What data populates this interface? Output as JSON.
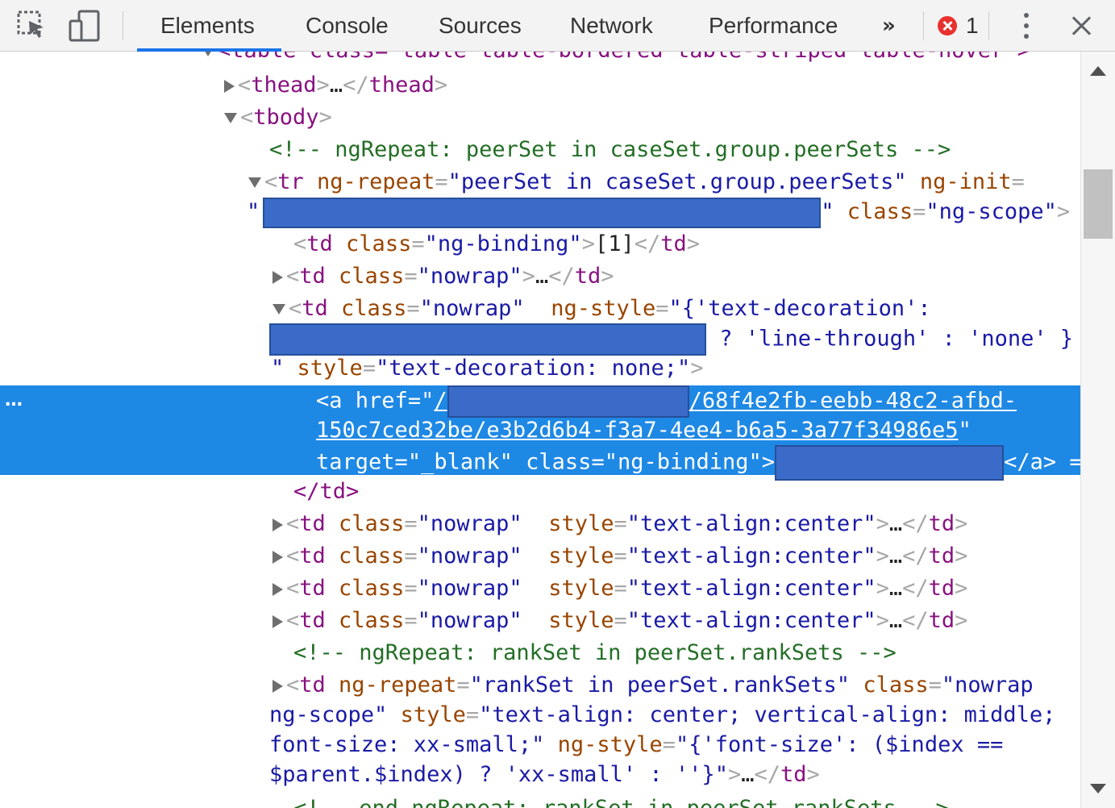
{
  "toolbar": {
    "tabs": [
      {
        "label": "Elements"
      },
      {
        "label": "Console"
      },
      {
        "label": "Sources"
      },
      {
        "label": "Network"
      },
      {
        "label": "Performance"
      }
    ],
    "more_tabs": "»",
    "error_count": "1",
    "icons": [
      "inspect-element-icon",
      "device-toolbar-icon",
      "more-tabs-icon",
      "error-icon",
      "kebab-menu-icon",
      "close-icon"
    ]
  },
  "dom": {
    "ellipsis": "…",
    "table_open_partial": "<table class=\"table table-bordered table-striped table-hover\">",
    "thead": "thead",
    "tbody": "tbody",
    "comment_ngrepeat_peer": "<!-- ngRepeat: peerSet in caseSet.group.peerSets -->",
    "tr_tag": "tr",
    "tr_attr1_name": "ng-repeat",
    "tr_attr1_value": "peerSet in caseSet.group.peerSets",
    "tr_attr2_name": "ng-init",
    "tr_attr3_name": "class",
    "tr_attr3_value": "ng-scope",
    "td_tag": "td",
    "attr_class": "class",
    "ng_binding": "ng-binding",
    "td1_text": "[1]",
    "nowrap": "nowrap",
    "ng_style_name": "ng-style",
    "ng_style_value_start": "{'text-decoration':",
    "ng_style_value_end": "? 'line-through' : 'none' }",
    "style_name": "style",
    "style_value": "text-decoration: none;",
    "a_tag": "a",
    "href_name": "href",
    "href_start": "/",
    "href_part1": "/68f4e2fb-eebb-48c2-afbd-",
    "href_part2": "150c7ced32be/e3b2d6b4-f3a7-4ee4-b6a5-3a77f34986e5",
    "target_name": "target",
    "target_value": "_blank",
    "a_close": "</a>",
    "a_tail": " ==",
    "td_close": "</td>",
    "text_align_center": "text-align:center",
    "comment_ngrepeat_rank": "<!-- ngRepeat: rankSet in peerSet.rankSets -->",
    "rank_repeat_value": "rankSet in peerSet.rankSets",
    "rank_class_value_1": "nowrap",
    "rank_class_value_2": "ng-scope",
    "rank_style_value_1": "text-align: center; vertical-align: middle;",
    "rank_style_value_2": "font-size: xx-small;",
    "rank_ngstyle_value_1": "{'font-size': ($index ==",
    "rank_ngstyle_value_2": "$parent.$index) ? 'xx-small' : ''}",
    "comment_end_partial": "<!-- end ngRepeat: rankSet in peerSet.rankSets -->"
  },
  "selection": {
    "marker": "…"
  }
}
